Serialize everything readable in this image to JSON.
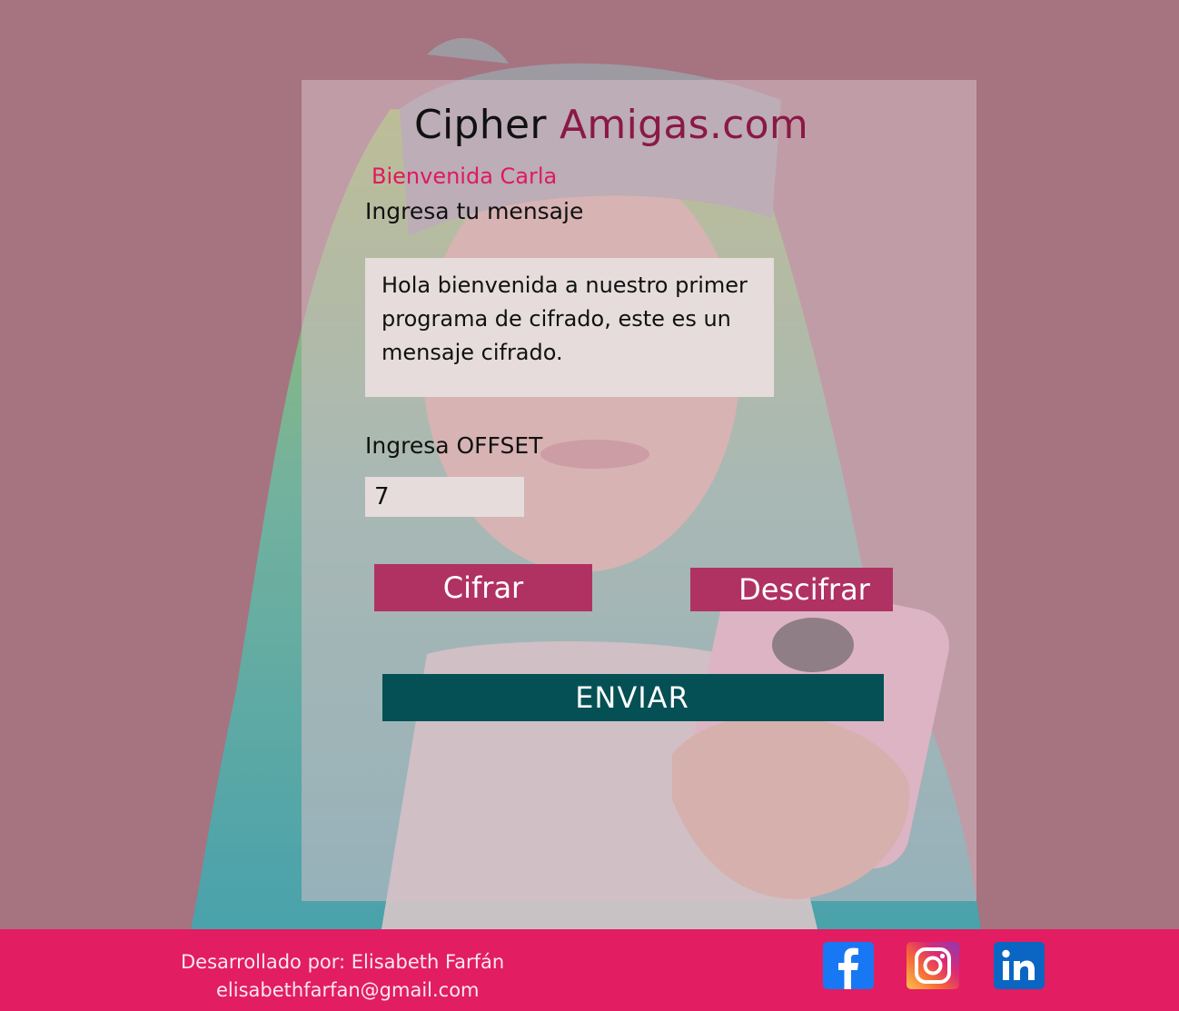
{
  "brand": {
    "title_part1": "Cipher",
    "title_part2": "Amigas.com"
  },
  "form": {
    "welcome": "Bienvenida Carla",
    "message_label": "Ingresa tu mensaje",
    "message_value": "Hola bienvenida a nuestro primer programa de cifrado, este es un mensaje cifrado.",
    "offset_label": "Ingresa OFFSET",
    "offset_value": "7"
  },
  "buttons": {
    "encrypt": "Cifrar",
    "decrypt": "Descifrar",
    "send": "ENVIAR"
  },
  "footer": {
    "credit": "Desarrollado por: Elisabeth Farfán",
    "email": "elisabethfarfan@gmail.com",
    "social": [
      {
        "name": "facebook-icon",
        "glyph": "f",
        "color": "#1878f3"
      },
      {
        "name": "instagram-icon",
        "color": "#dc2a73"
      },
      {
        "name": "linkedin-icon",
        "glyph": "in",
        "color": "#0a66c2"
      }
    ]
  },
  "colors": {
    "background": "#a67381",
    "accent_title": "#8b1845",
    "welcome": "#e0195f",
    "button_primary": "#b03262",
    "button_send": "#045055",
    "footer": "#e21d62"
  }
}
